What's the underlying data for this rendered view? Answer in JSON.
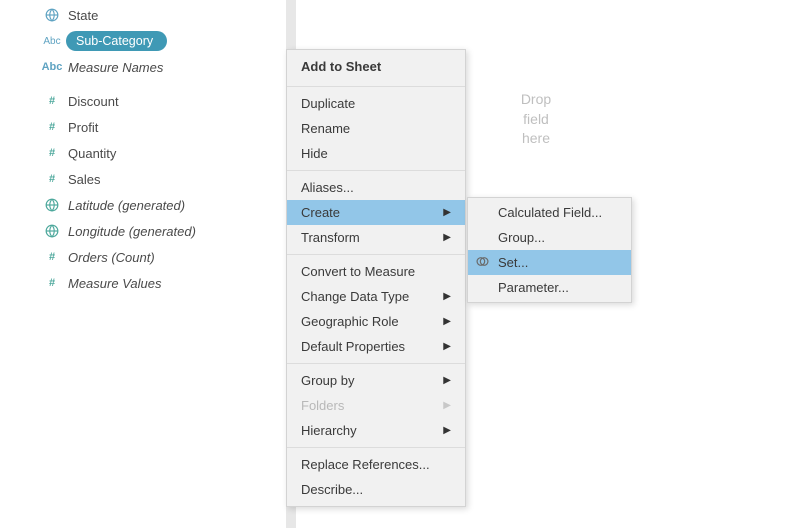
{
  "fields": {
    "state": "State",
    "subcategory": "Sub-Category",
    "measure_names": "Measure Names",
    "discount": "Discount",
    "profit": "Profit",
    "quantity": "Quantity",
    "sales": "Sales",
    "latitude": "Latitude (generated)",
    "longitude": "Longitude (generated)",
    "orders_count": "Orders (Count)",
    "measure_values": "Measure Values"
  },
  "drop_zone": {
    "line1": "Drop",
    "line2": "field",
    "line3": "here"
  },
  "context_menu": {
    "add_to_sheet": "Add to Sheet",
    "duplicate": "Duplicate",
    "rename": "Rename",
    "hide": "Hide",
    "aliases": "Aliases...",
    "create": "Create",
    "transform": "Transform",
    "convert_to_measure": "Convert to Measure",
    "change_data_type": "Change Data Type",
    "geographic_role": "Geographic Role",
    "default_properties": "Default Properties",
    "group_by": "Group by",
    "folders": "Folders",
    "hierarchy": "Hierarchy",
    "replace_references": "Replace References...",
    "describe": "Describe..."
  },
  "submenu": {
    "calculated_field": "Calculated Field...",
    "group": "Group...",
    "set": "Set...",
    "parameter": "Parameter..."
  },
  "icons": {
    "abc": "Abc",
    "hash": "#"
  }
}
